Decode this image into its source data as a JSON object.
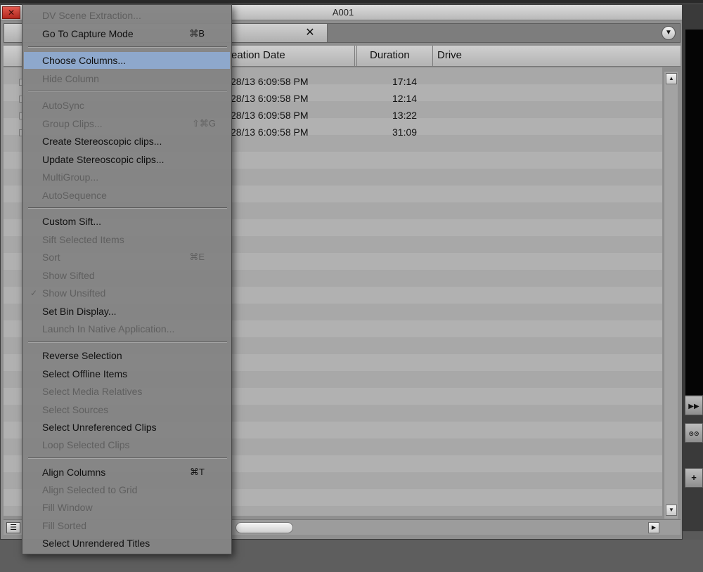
{
  "window": {
    "title": "A001",
    "close_glyph": "✕",
    "tab_close_glyph": "✕",
    "bin_menu_glyph": "▼"
  },
  "columns": [
    "eation Date",
    "Duration",
    "Drive"
  ],
  "rows": [
    {
      "date": "28/13 6:09:58 PM",
      "duration": "17:14",
      "drive": ""
    },
    {
      "date": "28/13 6:09:58 PM",
      "duration": "12:14",
      "drive": ""
    },
    {
      "date": "28/13 6:09:58 PM",
      "duration": "13:22",
      "drive": ""
    },
    {
      "date": "28/13 6:09:58 PM",
      "duration": "31:09",
      "drive": ""
    }
  ],
  "scrollbar": {
    "up": "▲",
    "down": "▼",
    "right": "▶",
    "view_toggle": "☰"
  },
  "side_controls": {
    "fast_forward": "▶▶",
    "link": "⊙⊙",
    "add": "+"
  },
  "menu": {
    "items": [
      {
        "label": "DV Scene Extraction...",
        "shortcut": "",
        "enabled": false,
        "checked": false
      },
      {
        "label": "Go To Capture Mode",
        "shortcut": "⌘B",
        "enabled": true,
        "checked": false
      },
      {
        "label": "Choose Columns...",
        "shortcut": "",
        "enabled": true,
        "checked": false,
        "highlighted": true
      },
      {
        "label": "Hide Column",
        "shortcut": "",
        "enabled": false,
        "checked": false
      },
      {
        "label": "AutoSync",
        "shortcut": "",
        "enabled": false,
        "checked": false
      },
      {
        "label": "Group Clips...",
        "shortcut": "⇧⌘G",
        "enabled": false,
        "checked": false
      },
      {
        "label": "Create Stereoscopic clips...",
        "shortcut": "",
        "enabled": true,
        "checked": false
      },
      {
        "label": "Update Stereoscopic clips...",
        "shortcut": "",
        "enabled": true,
        "checked": false
      },
      {
        "label": "MultiGroup...",
        "shortcut": "",
        "enabled": false,
        "checked": false
      },
      {
        "label": "AutoSequence",
        "shortcut": "",
        "enabled": false,
        "checked": false
      },
      {
        "label": "Custom Sift...",
        "shortcut": "",
        "enabled": true,
        "checked": false
      },
      {
        "label": "Sift Selected Items",
        "shortcut": "",
        "enabled": false,
        "checked": false
      },
      {
        "label": "Sort",
        "shortcut": "⌘E",
        "enabled": false,
        "checked": false
      },
      {
        "label": "Show Sifted",
        "shortcut": "",
        "enabled": false,
        "checked": false
      },
      {
        "label": "Show Unsifted",
        "shortcut": "",
        "enabled": false,
        "checked": true
      },
      {
        "label": "Set Bin Display...",
        "shortcut": "",
        "enabled": true,
        "checked": false
      },
      {
        "label": "Launch In Native Application...",
        "shortcut": "",
        "enabled": false,
        "checked": false
      },
      {
        "label": "Reverse Selection",
        "shortcut": "",
        "enabled": true,
        "checked": false
      },
      {
        "label": "Select Offline Items",
        "shortcut": "",
        "enabled": true,
        "checked": false
      },
      {
        "label": "Select Media Relatives",
        "shortcut": "",
        "enabled": false,
        "checked": false
      },
      {
        "label": "Select Sources",
        "shortcut": "",
        "enabled": false,
        "checked": false
      },
      {
        "label": "Select Unreferenced Clips",
        "shortcut": "",
        "enabled": true,
        "checked": false
      },
      {
        "label": "Loop Selected Clips",
        "shortcut": "",
        "enabled": false,
        "checked": false
      },
      {
        "label": "Align Columns",
        "shortcut": "⌘T",
        "enabled": true,
        "checked": false
      },
      {
        "label": "Align Selected to Grid",
        "shortcut": "",
        "enabled": false,
        "checked": false
      },
      {
        "label": "Fill Window",
        "shortcut": "",
        "enabled": false,
        "checked": false
      },
      {
        "label": "Fill Sorted",
        "shortcut": "",
        "enabled": false,
        "checked": false
      },
      {
        "label": "Select Unrendered Titles",
        "shortcut": "",
        "enabled": true,
        "checked": false
      }
    ],
    "check_glyph": "✓"
  },
  "colors": {
    "close_box": "#c8372c",
    "menu_highlight": "#8ea8cc",
    "menu_background": "#848484",
    "disabled_text": "#5f5f5f"
  }
}
